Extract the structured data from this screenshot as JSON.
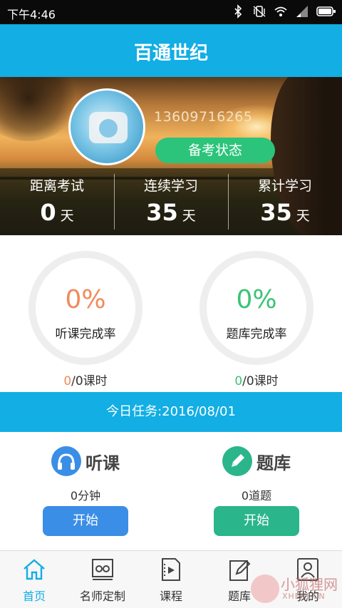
{
  "status_bar": {
    "time": "下午4:46",
    "icons": [
      "bluetooth-icon",
      "vibrate-icon",
      "wifi-icon",
      "signal-icon",
      "battery-icon"
    ]
  },
  "header": {
    "title": "百通世纪"
  },
  "profile": {
    "phone": "13609716265",
    "status_button": "备考状态"
  },
  "stats": [
    {
      "label": "距离考试",
      "value": "0",
      "unit": "天"
    },
    {
      "label": "连续学习",
      "value": "35",
      "unit": "天"
    },
    {
      "label": "累计学习",
      "value": "35",
      "unit": "天"
    }
  ],
  "progress": [
    {
      "percent": "0%",
      "label": "听课完成率",
      "done": "0",
      "total_text": "/0课时",
      "color": "#f08a5d"
    },
    {
      "percent": "0%",
      "label": "题库完成率",
      "done": "0",
      "total_text": "/0课时",
      "color": "#3cc277"
    }
  ],
  "task_banner": {
    "text": "今日任务:2016/08/01"
  },
  "tasks": [
    {
      "name": "听课",
      "amount": "0分钟",
      "button": "开始",
      "icon": "headphones-icon",
      "icon_color": "#3a8ee6",
      "button_color": "#3a8ee6"
    },
    {
      "name": "题库",
      "amount": "0道题",
      "button": "开始",
      "icon": "pencil-icon",
      "icon_color": "#2bb58a",
      "button_color": "#2bb58a"
    }
  ],
  "bottom_nav": [
    {
      "label": "首页",
      "icon": "home-icon",
      "active": true
    },
    {
      "label": "名师定制",
      "icon": "teacher-icon",
      "active": false
    },
    {
      "label": "课程",
      "icon": "video-course-icon",
      "active": false
    },
    {
      "label": "题库",
      "icon": "edit-book-icon",
      "active": false
    },
    {
      "label": "我的",
      "icon": "profile-icon",
      "active": false
    }
  ],
  "watermark": {
    "text": "小狐狸网",
    "url": "XHEKJ.CN"
  },
  "colors": {
    "primary": "#12aee4",
    "green": "#2bc47a",
    "orange": "#f08a5d"
  }
}
